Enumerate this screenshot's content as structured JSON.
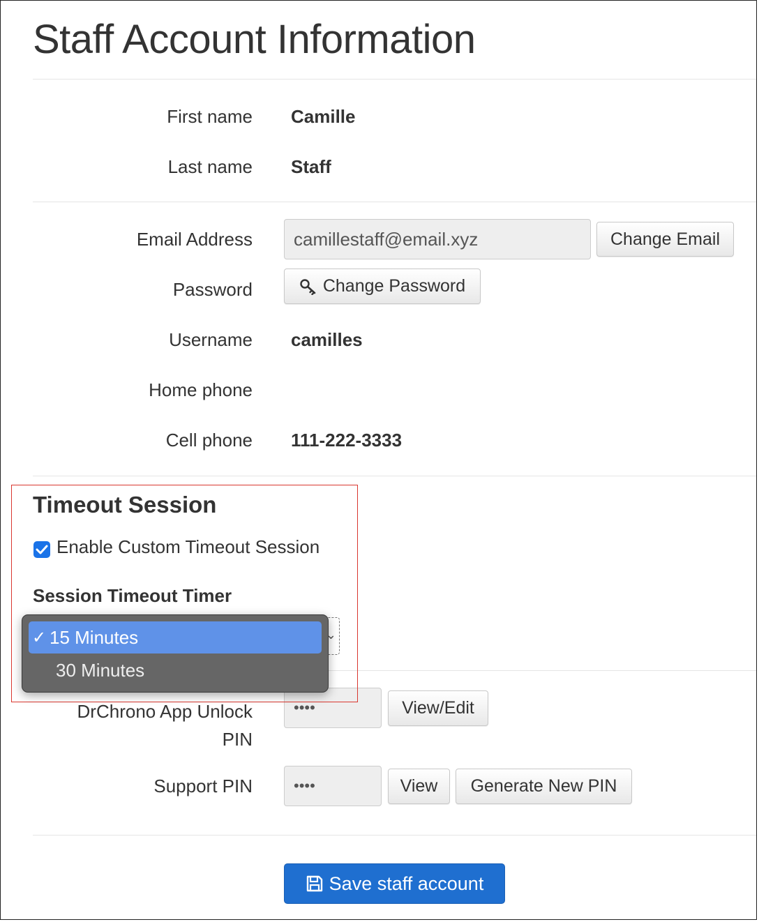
{
  "page": {
    "title": "Staff Account Information"
  },
  "profile": {
    "first_name_label": "First name",
    "first_name": "Camille",
    "last_name_label": "Last name",
    "last_name": "Staff"
  },
  "account": {
    "email_label": "Email Address",
    "email_value": "camillestaff@email.xyz",
    "change_email": "Change Email",
    "password_label": "Password",
    "change_password": "Change Password",
    "username_label": "Username",
    "username": "camilles",
    "home_phone_label": "Home phone",
    "home_phone": "",
    "cell_phone_label": "Cell phone",
    "cell_phone": "111-222-3333"
  },
  "timeout": {
    "heading": "Timeout Session",
    "enable_label": "Enable Custom Timeout Session",
    "enabled": true,
    "timer_label": "Session Timeout Timer",
    "options": [
      "15 Minutes",
      "30 Minutes"
    ],
    "selected": "15 Minutes",
    "check_mark": "✓"
  },
  "pins": {
    "app_unlock_label_line1": "DrChrono App Unlock",
    "app_unlock_label_line2": "PIN",
    "app_unlock_value": "••••",
    "view_edit": "View/Edit",
    "support_label": "Support PIN",
    "support_value": "••••",
    "view": "View",
    "generate": "Generate New PIN"
  },
  "footer": {
    "save_label": "Save staff account"
  },
  "colors": {
    "primary": "#1f6fd0",
    "highlight": "#5f92e8",
    "annotation": "#d9372f",
    "checkbox": "#1a73e8"
  },
  "icons": {
    "password": "key-icon",
    "save": "floppy-disk-icon",
    "checkbox": "checkmark-icon"
  }
}
